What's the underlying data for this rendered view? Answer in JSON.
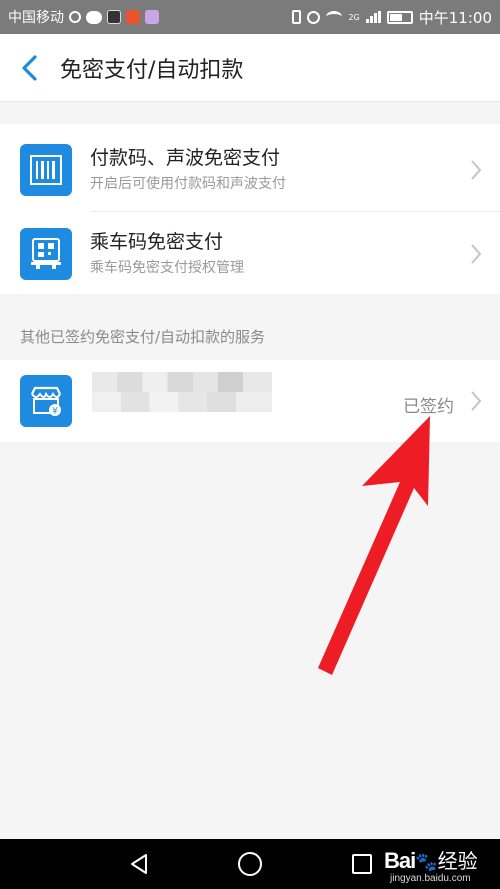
{
  "status_bar": {
    "carrier": "中国移动",
    "network": "2G",
    "time": "中午11:00"
  },
  "header": {
    "title": "免密支付/自动扣款"
  },
  "main_items": [
    {
      "title": "付款码、声波免密支付",
      "subtitle": "开启后可使用付款码和声波支付",
      "icon": "barcode-icon"
    },
    {
      "title": "乘车码免密支付",
      "subtitle": "乘车码免密支付授权管理",
      "icon": "bus-qr-icon"
    }
  ],
  "other_section": {
    "label": "其他已签约免密支付/自动扣款的服务",
    "items": [
      {
        "status": "已签约",
        "icon": "store-icon"
      }
    ]
  },
  "watermark": {
    "brand": "Bai",
    "brand_cn": "经验",
    "url": "jingyan.baidu.com"
  },
  "colors": {
    "accent": "#1f8be0",
    "arrow": "#ee1c24",
    "status_bar": "#7b7b7b"
  }
}
